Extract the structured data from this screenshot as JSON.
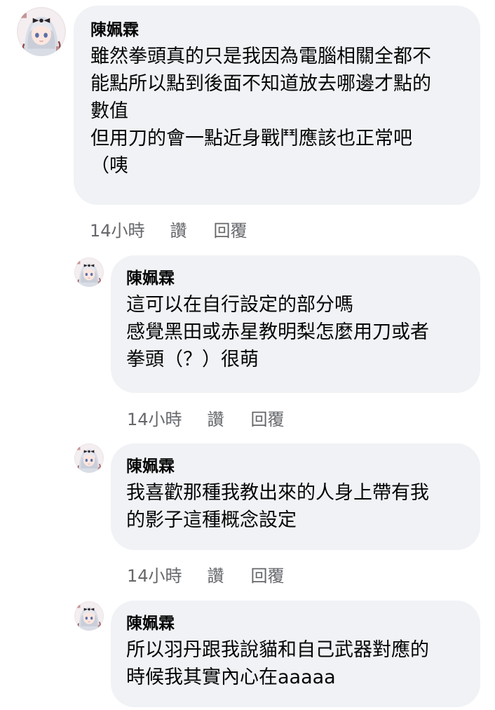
{
  "comments": [
    {
      "author": "陳姵霖",
      "lines": [
        "雖然拳頭真的只是我因為電腦相關全都不",
        "能點所以點到後面不知道放去哪邊才點的",
        "數值",
        "但用刀的會一點近身戰鬥應該也正常吧",
        "（咦"
      ],
      "time": "14小時",
      "like": "讚",
      "reply": "回覆"
    },
    {
      "author": "陳姵霖",
      "lines": [
        "這可以在自行設定的部分嗎",
        "感覺黑田或赤星教明梨怎麼用刀或者",
        "拳頭（？）很萌"
      ],
      "time": "14小時",
      "like": "讚",
      "reply": "回覆"
    },
    {
      "author": "陳姵霖",
      "lines": [
        "我喜歡那種我教出來的人身上帶有我",
        "的影子這種概念設定"
      ],
      "time": "14小時",
      "like": "讚",
      "reply": "回覆"
    },
    {
      "author": "陳姵霖",
      "lines": [
        "所以羽丹跟我說貓和自己武器對應的",
        "時候我其實內心在aaaaa"
      ]
    }
  ]
}
